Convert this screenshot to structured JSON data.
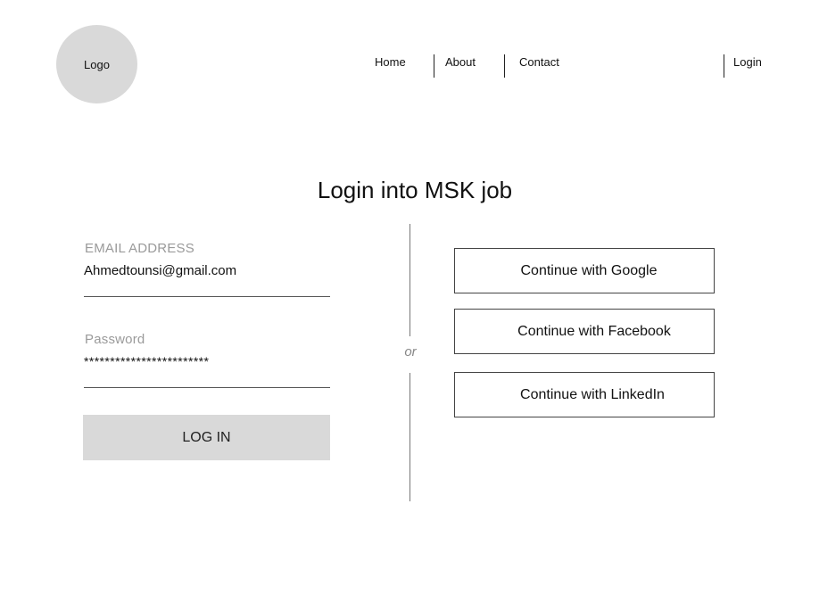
{
  "header": {
    "logo_text": "Logo",
    "nav": {
      "home": "Home",
      "about": "About",
      "contact": "Contact",
      "login": "Login"
    }
  },
  "main": {
    "title": "Login into MSK job",
    "form": {
      "email_label": "EMAIL ADDRESS",
      "email_value": "Ahmedtounsi@gmail.com",
      "password_label": "Password",
      "password_value": "************************",
      "submit_label": "LOG IN"
    },
    "separator_text": "or",
    "social": {
      "google": "Continue with Google",
      "facebook": "Continue with Facebook",
      "linkedin": "Continue with LinkedIn"
    }
  },
  "colors": {
    "logo_bg": "#d9d9d9",
    "button_bg": "#d9d9d9",
    "label_gray": "#9a9a9a"
  }
}
